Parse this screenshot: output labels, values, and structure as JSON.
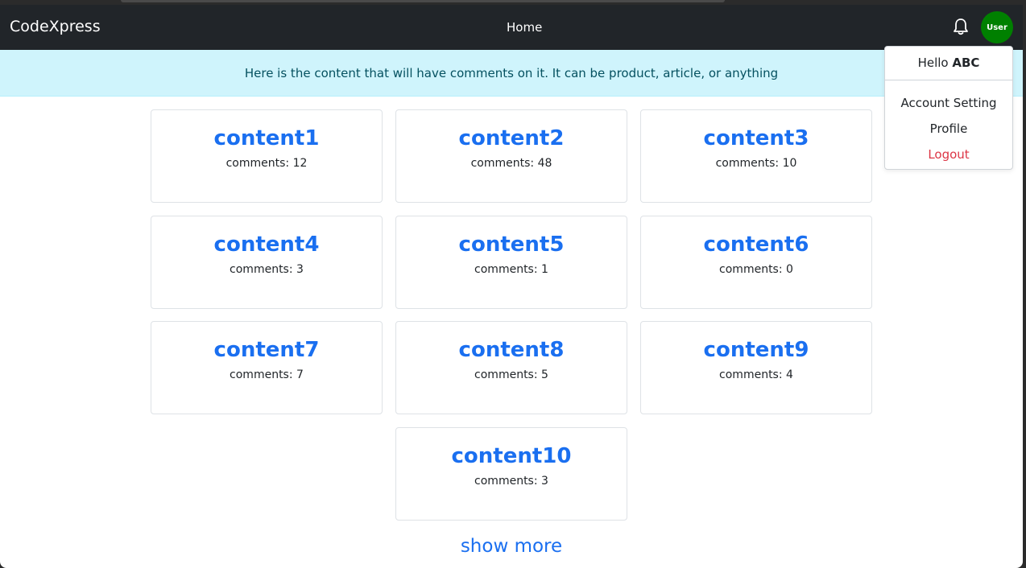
{
  "navbar": {
    "brand": "CodeXpress",
    "home_label": "Home",
    "avatar_label": "User",
    "avatar_color": "#008000"
  },
  "alert": {
    "text": "Here is the content that will have comments on it. It can be product, article, or anything"
  },
  "contents": [
    {
      "title": "content1",
      "comments": "comments: 12"
    },
    {
      "title": "content2",
      "comments": "comments: 48"
    },
    {
      "title": "content3",
      "comments": "comments: 10"
    },
    {
      "title": "content4",
      "comments": "comments: 3"
    },
    {
      "title": "content5",
      "comments": "comments: 1"
    },
    {
      "title": "content6",
      "comments": "comments: 0"
    },
    {
      "title": "content7",
      "comments": "comments: 7"
    },
    {
      "title": "content8",
      "comments": "comments: 5"
    },
    {
      "title": "content9",
      "comments": "comments: 4"
    },
    {
      "title": "content10",
      "comments": "comments: 3"
    }
  ],
  "show_more_label": "show more",
  "user_menu": {
    "greeting": "Hello",
    "username": "ABC",
    "items": [
      {
        "label": "Account Setting"
      },
      {
        "label": "Profile"
      },
      {
        "label": "Logout"
      }
    ]
  },
  "colors": {
    "link": "#1a6ff0",
    "logout": "#dc3545",
    "alert_bg": "#cff4fc"
  },
  "icons": {
    "bell": "bell-icon"
  }
}
